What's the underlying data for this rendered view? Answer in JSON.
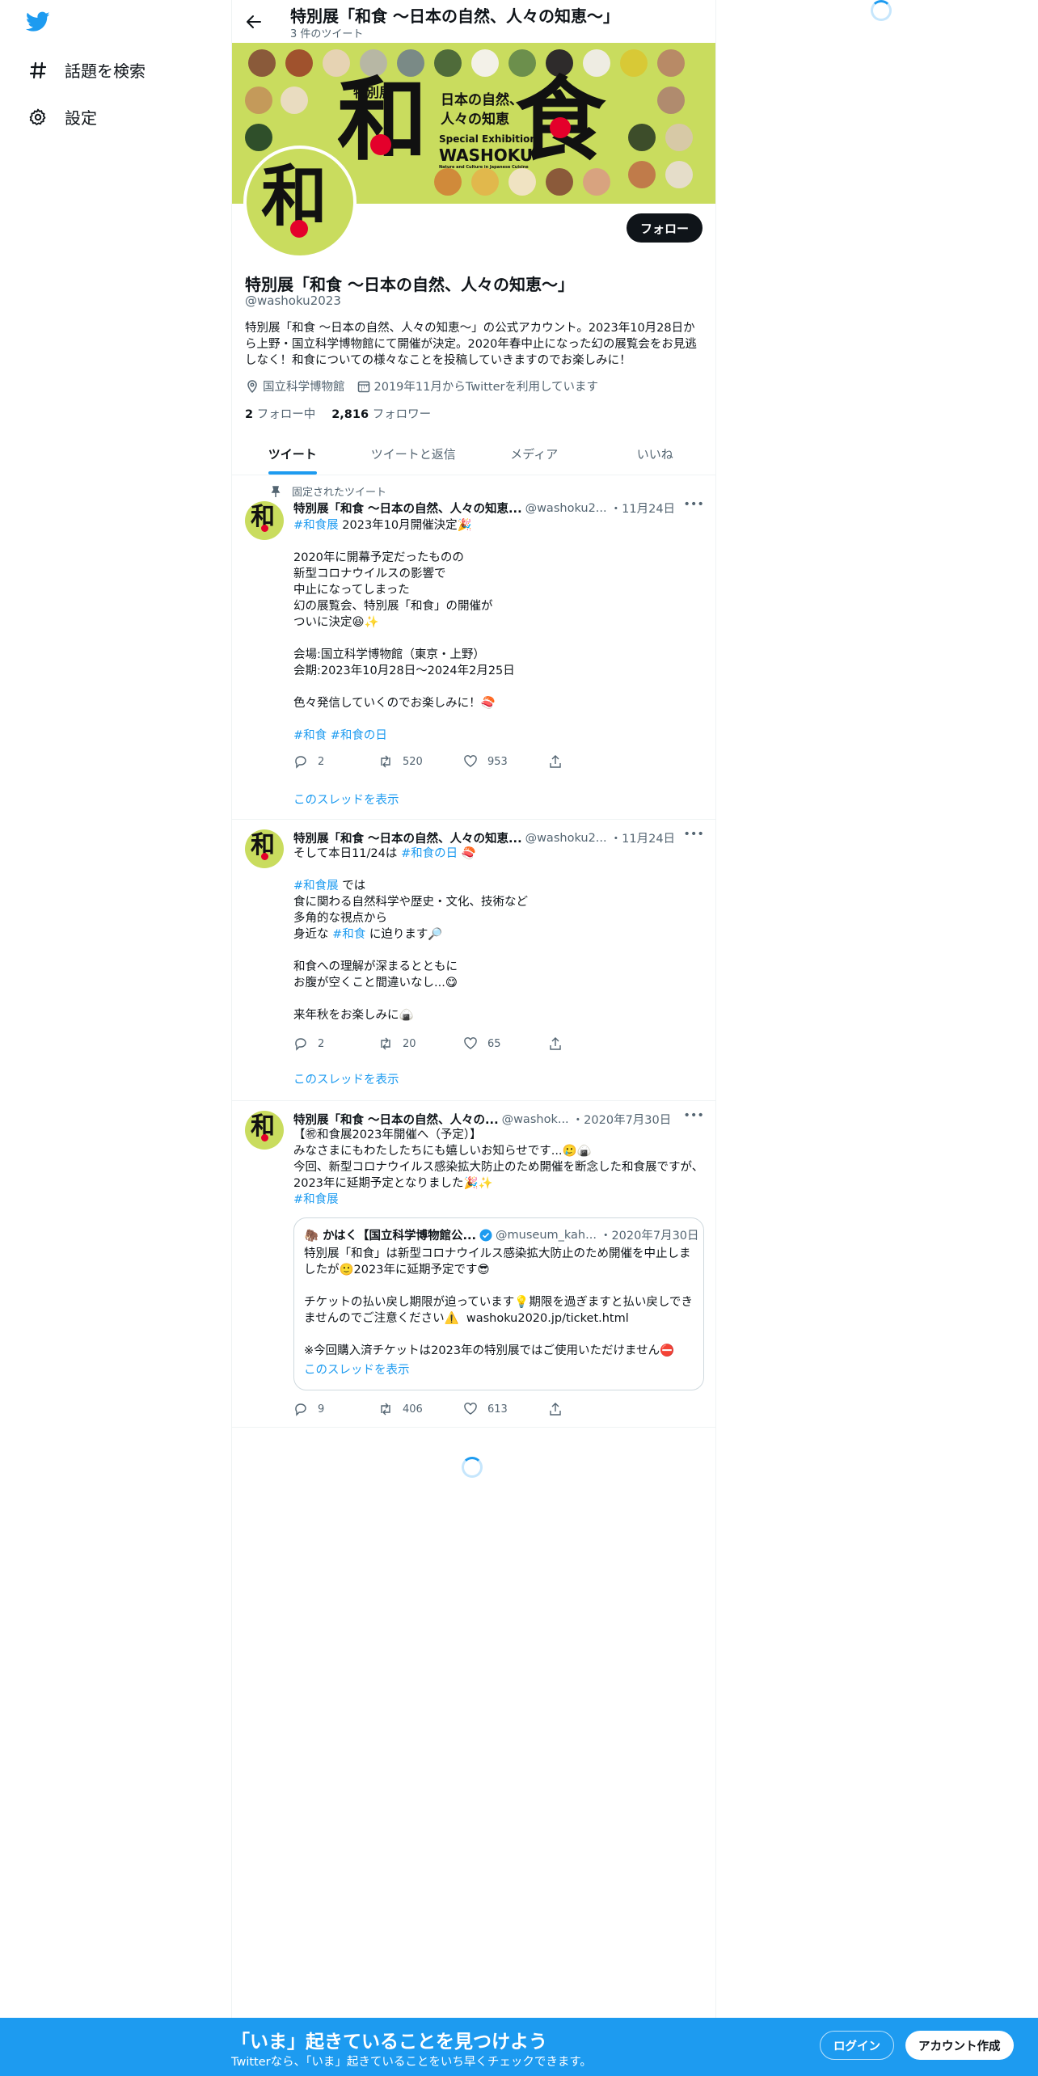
{
  "nav": {
    "explore": "話題を検索",
    "settings": "設定",
    "logo_icon": "twitter-bird-icon"
  },
  "header": {
    "title": "特別展「和食 ～日本の自然、人々の知恵～」",
    "tweet_count": "3 件のツイート"
  },
  "banner": {
    "big_left": "和",
    "big_right": "食",
    "tokubetsu": "特別展",
    "subtitle_1": "日本の自然、",
    "subtitle_2": "人々の知恵",
    "special": "Special Exhibition",
    "washoku": "WASHOKU",
    "tiny": "Nature and Culture in Japanese Cuisine",
    "colors": {
      "bg": "#c9dc5e",
      "accent_red": "#e4002b"
    }
  },
  "profile": {
    "avatar_char": "和",
    "follow_label": "フォロー",
    "name": "特別展「和食 ～日本の自然、人々の知恵～」",
    "handle": "@washoku2023",
    "bio": "特別展「和食 ～日本の自然、人々の知恵～」の公式アカウント。2023年10月28日から上野・国立科学博物館にて開催が決定。2020年春中止になった幻の展覧会をお見逃しなく！和食についての様々なことを投稿していきますのでお楽しみに！",
    "location": "国立科学博物館",
    "joined": "2019年11月からTwitterを利用しています",
    "following_count": "2",
    "following_label": "フォロー中",
    "followers_count": "2,816",
    "followers_label": "フォロワー"
  },
  "tabs": [
    "ツイート",
    "ツイートと返信",
    "メディア",
    "いいね"
  ],
  "tweets": [
    {
      "pinned_label": "固定されたツイート",
      "name": "特別展「和食 ～日本の自然、人々の知恵...",
      "handle": "@washoku2...",
      "date": "・11月24日",
      "body_tag": "#和食展",
      "body_first": " 2023年10月開催決定🎉",
      "body": "2020年に開幕予定だったものの\n新型コロナウイルスの影響で\n中止になってしまった\n幻の展覧会、特別展「和食」の開催が\nついに決定😆✨\n\n会場:国立科学博物館（東京・上野）\n会期:2023年10月28日〜2024年2月25日\n\n色々発信していくのでお楽しみに！🍣",
      "tags": "#和食 #和食の日",
      "replies": "2",
      "retweets": "520",
      "likes": "953",
      "thread": "このスレッドを表示"
    },
    {
      "name": "特別展「和食 ～日本の自然、人々の知恵...",
      "handle": "@washoku2...",
      "date": "・11月24日",
      "line1_a": "そして本日11/24は ",
      "line1_tag": "#和食の日",
      "line1_b": " 🍣",
      "line2_tag": "#和食展",
      "line2_b": " では",
      "line3": "食に関わる自然科学や歴史・文化、技術など\n多角的な視点から",
      "line4_a": "身近な ",
      "line4_tag": "#和食",
      "line4_b": " に迫ります🔎",
      "line5": "和食への理解が深まるとともに\nお腹が空くこと間違いなし...😋\n\n来年秋をお楽しみに🍙",
      "replies": "2",
      "retweets": "20",
      "likes": "65",
      "thread": "このスレッドを表示"
    },
    {
      "name": "特別展「和食 ～日本の自然、人々の...",
      "handle": "@washok...",
      "date": "・2020年7月30日",
      "body": "【㊗和食展2023年開催へ（予定）】\nみなさまにもわたしたちにも嬉しいお知らせです...🥲🍙\n今回、新型コロナウイルス感染拡大防止のため開催を断念した和食展ですが、2023年に延期予定となりました🎉✨",
      "tag": "#和食展",
      "quote": {
        "name": "🦣 かはく【国立科学博物館公...",
        "verified_icon": "verified-badge-icon",
        "handle": "@museum_kah...",
        "date": "・2020年7月30日",
        "body": "特別展「和食」は新型コロナウイルス感染拡大防止のため開催を中止しましたが🙂2023年に延期予定です😎\n\nチケットの払い戻し期限が迫っています💡期限を過ぎますと払い戻しできませんのでご注意ください⚠️  washoku2020.jp/ticket.html\n\n※今回購入済チケットは2023年の特別展ではご使用いただけません⛔",
        "thread": "このスレッドを表示"
      },
      "replies": "9",
      "retweets": "406",
      "likes": "613"
    }
  ],
  "bottombar": {
    "title": "「いま」起きていることを見つけよう",
    "subtitle": "Twitterなら、「いま」起きていることをいち早くチェックできます。",
    "login": "ログイン",
    "signup": "アカウント作成",
    "bg_color": "#1d9bf0"
  }
}
